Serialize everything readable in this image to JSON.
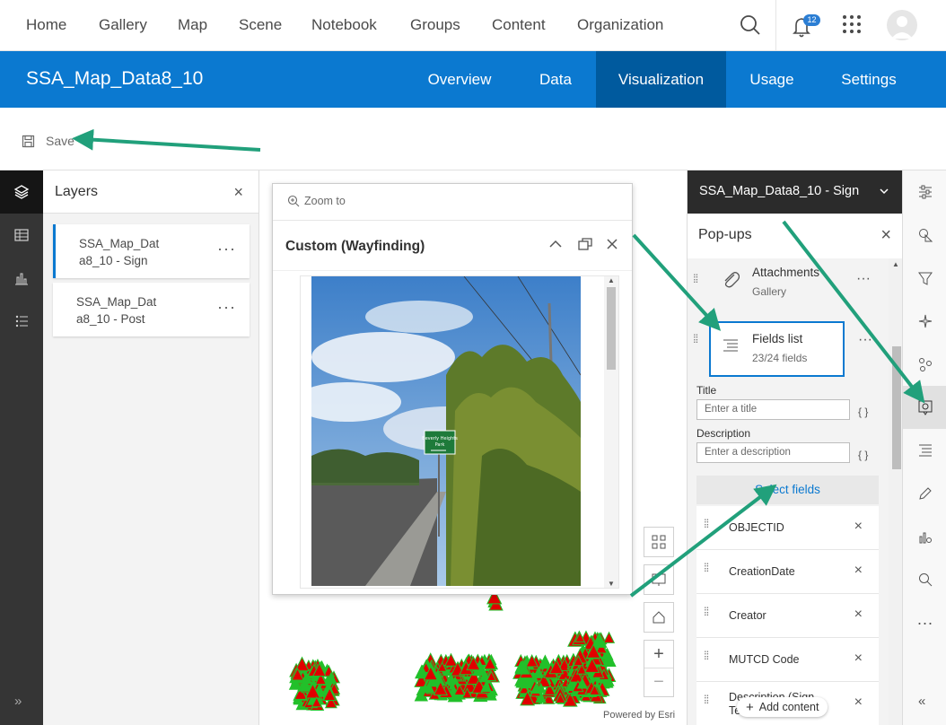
{
  "topnav": {
    "items": [
      "Home",
      "Gallery",
      "Map",
      "Scene",
      "Notebook",
      "Groups",
      "Content",
      "Organization"
    ],
    "notification_count": "12"
  },
  "item_header": {
    "title": "SSA_Map_Data8_10",
    "tabs": [
      "Overview",
      "Data",
      "Visualization",
      "Usage",
      "Settings"
    ],
    "active_tab": "Visualization"
  },
  "toolbar": {
    "save_label": "Save"
  },
  "layers_panel": {
    "title": "Layers",
    "layers": [
      {
        "name_line1": "SSA_Map_Dat",
        "name_line2": "a8_10 - Sign",
        "selected": true
      },
      {
        "name_line1": "SSA_Map_Dat",
        "name_line2": "a8_10 - Post",
        "selected": false
      }
    ]
  },
  "popup": {
    "zoom_label": "Zoom to",
    "title": "Custom (Wayfinding)",
    "sign_text_1": "Beverly Heights",
    "sign_text_2": "Park"
  },
  "map": {
    "powered_by": "Powered by Esri"
  },
  "config_panel": {
    "layer_select": "SSA_Map_Data8_10 - Sign",
    "title": "Pop-ups",
    "attachments": {
      "label": "Attachments",
      "sub": "Gallery"
    },
    "fields_list": {
      "label": "Fields list",
      "count": "23/24 fields"
    },
    "title_label": "Title",
    "title_placeholder": "Enter a title",
    "description_label": "Description",
    "description_placeholder": "Enter a description",
    "braces": "{ }",
    "select_fields_label": "Select fields",
    "fields": [
      "OBJECTID",
      "CreationDate",
      "Creator",
      "MUTCD Code",
      "Description (Sign Te..."
    ],
    "add_content_label": "Add content"
  },
  "colors": {
    "brand_blue": "#0b79d0",
    "active_tab_blue": "#005a9e",
    "arrow_green": "#21a07b",
    "marker_red": "#e00000",
    "marker_green": "#22c02a"
  }
}
